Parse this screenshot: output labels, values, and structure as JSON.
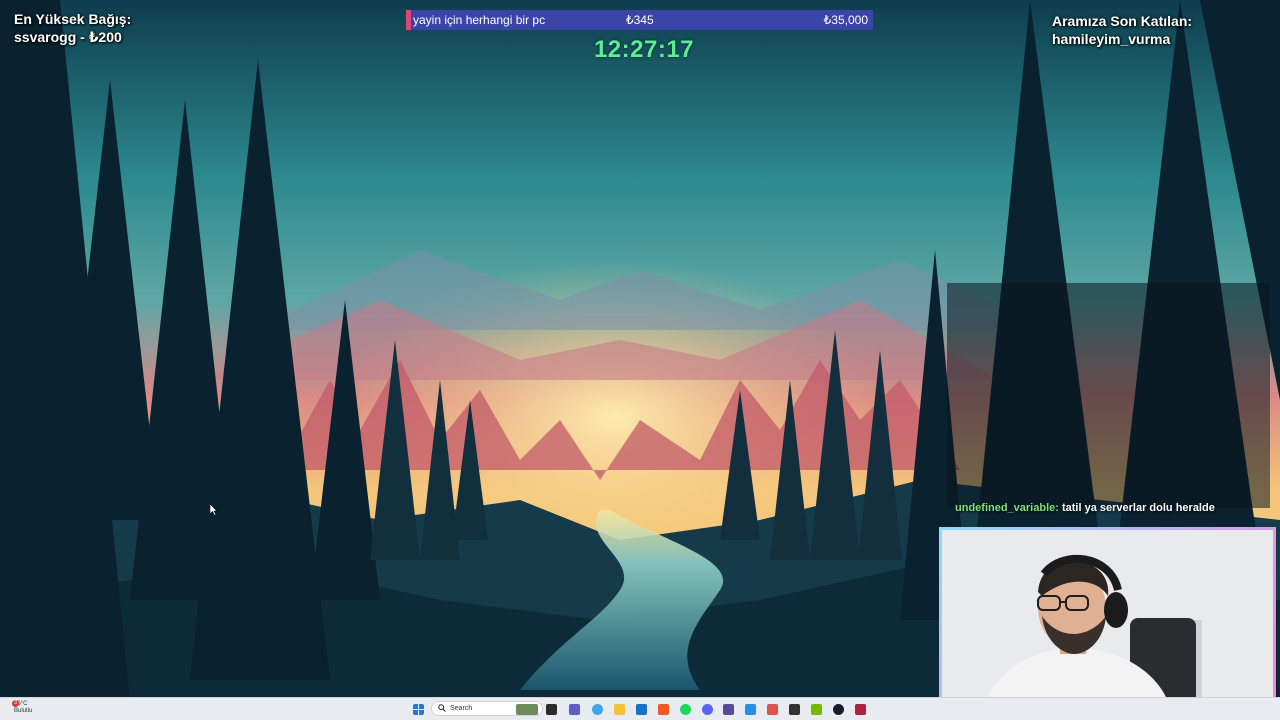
{
  "top_donor": {
    "heading": "En Yüksek Bağış:",
    "value": "ssvarogg - ₺200"
  },
  "recent_follower": {
    "heading": "Aramıza Son Katılan:",
    "value": "hamileyim_vurma"
  },
  "goal": {
    "title": "yayin için herhangi bir pc",
    "current": "₺345",
    "target": "₺35,000",
    "progress_fraction": 0.0099,
    "fill_color": "#e0457a",
    "track_color": "#3b45a8"
  },
  "clock": {
    "time": "12:27:17",
    "color": "#58f090"
  },
  "chat": {
    "user": "undefined_variable:",
    "message": " tatil ya serverlar dolu heralde",
    "user_color": "#7fe07a"
  },
  "taskbar": {
    "weather_temp": "16°C",
    "weather_desc": "Bulutlu",
    "weather_badge": "3",
    "search_label": "Search",
    "icons": [
      "windows-start-icon",
      "search-icon",
      "widgets-icon",
      "task-view-icon",
      "teams-icon",
      "copilot-icon",
      "file-explorer-icon",
      "outlook-icon",
      "brave-icon",
      "spotify-icon",
      "discord-icon",
      "git-icon",
      "vscode-icon",
      "terminal-icon",
      "xampp-icon",
      "nvidia-icon",
      "obs-icon",
      "app-icon"
    ]
  }
}
